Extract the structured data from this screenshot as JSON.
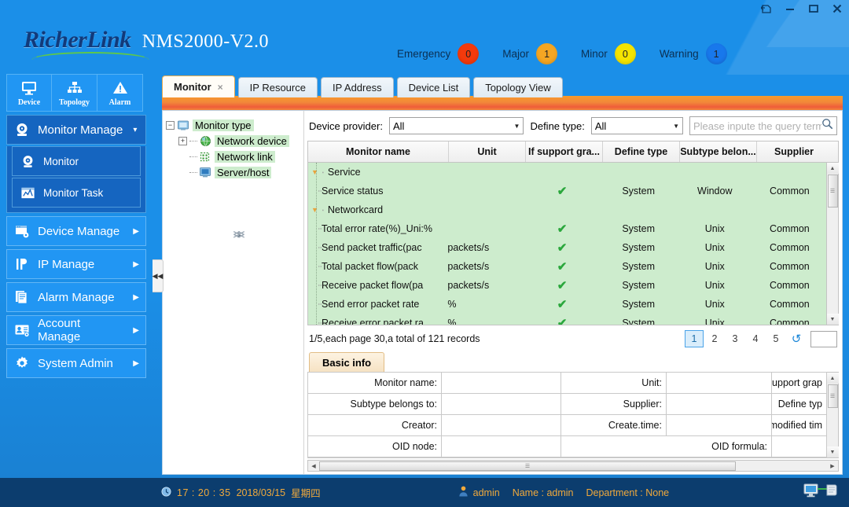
{
  "window": {
    "controls": [
      {
        "name": "restore-down-icon",
        "title": "Restore"
      },
      {
        "name": "minimize-icon",
        "title": "Minimize"
      },
      {
        "name": "maximize-icon",
        "title": "Maximize"
      },
      {
        "name": "close-icon",
        "title": "Close"
      }
    ]
  },
  "brand": {
    "name": "RicherLink",
    "product": "NMS2000-V2.0"
  },
  "alarms": [
    {
      "label": "Emergency",
      "count": "0",
      "color": "#f33a0c"
    },
    {
      "label": "Major",
      "count": "1",
      "color": "#f5a623"
    },
    {
      "label": "Minor",
      "count": "0",
      "color": "#f5e400"
    },
    {
      "label": "Warning",
      "count": "1",
      "color": "#1878ec"
    }
  ],
  "quickbar": [
    {
      "label": "Device",
      "icon": "monitor-icon"
    },
    {
      "label": "Topology",
      "icon": "topology-icon"
    },
    {
      "label": "Alarm",
      "icon": "alarm-triangle-icon"
    }
  ],
  "sidebar": {
    "group": {
      "label": "Monitor Manage",
      "icon": "monitor-manage-icon",
      "caret": "▾",
      "children": [
        {
          "label": "Monitor",
          "icon": "monitor-eye-icon"
        },
        {
          "label": "Monitor Task",
          "icon": "chart-window-icon"
        }
      ]
    },
    "items": [
      {
        "label": "Device Manage",
        "icon": "device-icon",
        "chevron": "▶"
      },
      {
        "label": "IP Manage",
        "icon": "ip-icon",
        "chevron": "▶"
      },
      {
        "label": "Alarm Manage",
        "icon": "alarm-list-icon",
        "chevron": "▶"
      },
      {
        "label": "Account Manage",
        "icon": "account-icon",
        "chevron": "▶"
      },
      {
        "label": "System Admin",
        "icon": "gear-icon",
        "chevron": "▶"
      }
    ]
  },
  "collapse_handle": {
    "glyph": "◀◀"
  },
  "tabs": [
    {
      "label": "Monitor",
      "active": true,
      "closable": true,
      "close_glyph": "×"
    },
    {
      "label": "IP Resource",
      "active": false
    },
    {
      "label": "IP Address",
      "active": false
    },
    {
      "label": "Device List",
      "active": false
    },
    {
      "label": "Topology View",
      "active": false
    }
  ],
  "tree": [
    {
      "label": "Monitor type",
      "depth": 0,
      "handle": "−",
      "icon": "folder-icon"
    },
    {
      "label": "Network device",
      "depth": 1,
      "handle": "+",
      "icon": "globe-icon"
    },
    {
      "label": "Network link",
      "depth": 1,
      "handle": "",
      "icon": "link-icon"
    },
    {
      "label": "Server/host",
      "depth": 1,
      "handle": "",
      "icon": "server-icon"
    }
  ],
  "filters": {
    "provider_label": "Device provider:",
    "provider_value": "All",
    "define_label": "Define type:",
    "define_value": "All",
    "search_placeholder": "Please inpute the query term",
    "search_value": "",
    "search_icon": "search-icon"
  },
  "table": {
    "columns": [
      "Monitor name",
      "Unit",
      "If support gra...",
      "Define type",
      "Subtype belon...",
      "Supplier"
    ],
    "rows": [
      {
        "type": "group",
        "name": "Service"
      },
      {
        "type": "leaf",
        "name": "Service status",
        "unit": "",
        "graph": "✔",
        "define": "System",
        "subtype": "Window",
        "supplier": "Common"
      },
      {
        "type": "group",
        "name": "Networkcard"
      },
      {
        "type": "leaf",
        "name": "Total error rate(%)_Uni:%",
        "unit": "",
        "graph": "✔",
        "define": "System",
        "subtype": "Unix",
        "supplier": "Common"
      },
      {
        "type": "leaf",
        "name": "Send packet traffic(pac",
        "unit": "packets/s",
        "graph": "✔",
        "define": "System",
        "subtype": "Unix",
        "supplier": "Common"
      },
      {
        "type": "leaf",
        "name": "Total packet flow(pack",
        "unit": "packets/s",
        "graph": "✔",
        "define": "System",
        "subtype": "Unix",
        "supplier": "Common"
      },
      {
        "type": "leaf",
        "name": "Receive packet flow(pa",
        "unit": "packets/s",
        "graph": "✔",
        "define": "System",
        "subtype": "Unix",
        "supplier": "Common"
      },
      {
        "type": "leaf",
        "name": "Send error packet rate",
        "unit": "%",
        "graph": "✔",
        "define": "System",
        "subtype": "Unix",
        "supplier": "Common"
      },
      {
        "type": "leaf",
        "name": "Receive error packet ra",
        "unit": "%",
        "graph": "✔",
        "define": "System",
        "subtype": "Unix",
        "supplier": "Common"
      }
    ]
  },
  "pager": {
    "info": "1/5,each page 30,a total of 121 records",
    "first": "≪",
    "prev": "‹",
    "pages": [
      "1",
      "2",
      "3",
      "4",
      "5"
    ],
    "current": "1",
    "next": "›",
    "last": "≫",
    "refresh": "↺",
    "jump_value": ""
  },
  "info_panel": {
    "tab_label": "Basic info",
    "rows": [
      [
        "Monitor name:",
        "",
        "Unit:",
        "",
        "If support grap"
      ],
      [
        "Subtype belongs to:",
        "",
        "Supplier:",
        "",
        "Define typ"
      ],
      [
        "Creator:",
        "",
        "Create.time:",
        "",
        "Latest modified tim"
      ],
      [
        "OID node:",
        "",
        "OID formula:",
        "",
        ""
      ]
    ]
  },
  "statusbar": {
    "clock_icon": "clock-icon",
    "time": "17 : 20 : 35",
    "date": "2018/03/15",
    "weekday": "星期四",
    "user_icon": "user-icon",
    "user": "admin",
    "name": "Name : admin",
    "department": "Department : None",
    "link_icon": "server-link-icon"
  }
}
